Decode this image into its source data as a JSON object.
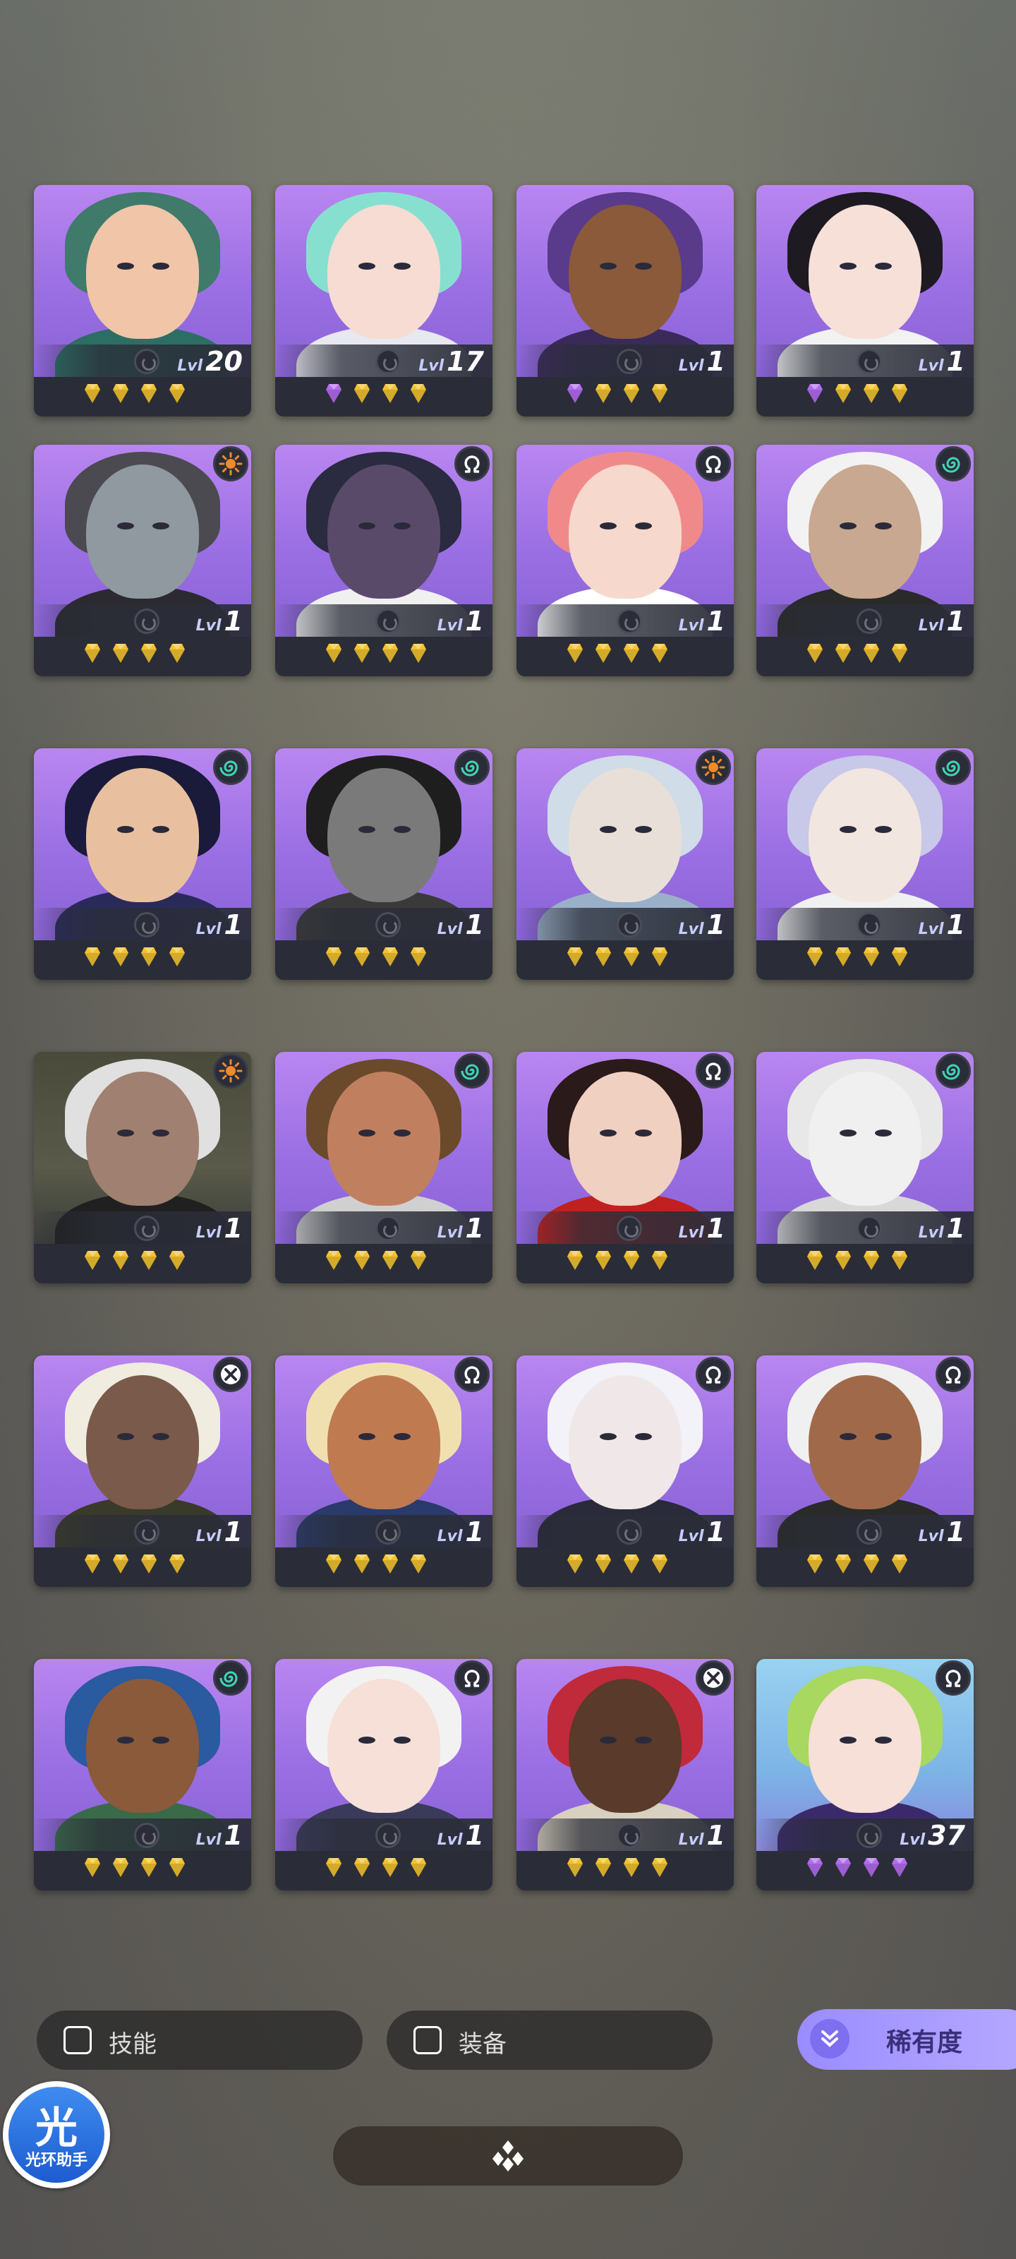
{
  "level_label": "Lvl",
  "heroes": [
    {
      "level": "20",
      "gems": [
        "gold",
        "gold",
        "gold",
        "gold"
      ],
      "badge": "",
      "palette": [
        "#3f7a6a",
        "#f1c5a8",
        "#2c6e63"
      ],
      "bg": "purple"
    },
    {
      "level": "17",
      "gems": [
        "purple",
        "gold",
        "gold",
        "gold"
      ],
      "badge": "",
      "palette": [
        "#87e0cf",
        "#f6dcd2",
        "#e8e8f0"
      ],
      "bg": "purple"
    },
    {
      "level": "1",
      "gems": [
        "purple",
        "gold",
        "gold",
        "gold"
      ],
      "badge": "",
      "palette": [
        "#5a3a8a",
        "#8a5a3a",
        "#3a2a5a"
      ],
      "bg": "purple"
    },
    {
      "level": "1",
      "gems": [
        "purple",
        "gold",
        "gold",
        "gold"
      ],
      "badge": "",
      "palette": [
        "#1e1a22",
        "#f6e0d8",
        "#f2f2f2"
      ],
      "bg": "purple"
    },
    {
      "level": "1",
      "gems": [
        "gold",
        "gold",
        "gold",
        "gold"
      ],
      "badge": "sun",
      "palette": [
        "#4a4a50",
        "#9098a0",
        "#2a2a30"
      ],
      "bg": "purple"
    },
    {
      "level": "1",
      "gems": [
        "gold",
        "gold",
        "gold",
        "gold"
      ],
      "badge": "omega",
      "palette": [
        "#2a2a40",
        "#5a4a6a",
        "#f0f0f0"
      ],
      "bg": "purple"
    },
    {
      "level": "1",
      "gems": [
        "gold",
        "gold",
        "gold",
        "gold"
      ],
      "badge": "omega",
      "palette": [
        "#f08a8a",
        "#f6d8cc",
        "#ffffff"
      ],
      "bg": "purple"
    },
    {
      "level": "1",
      "gems": [
        "gold",
        "gold",
        "gold",
        "gold"
      ],
      "badge": "spiral",
      "palette": [
        "#f2f2f2",
        "#c8a890",
        "#2a2a2a"
      ],
      "bg": "purple"
    },
    {
      "level": "1",
      "gems": [
        "gold",
        "gold",
        "gold",
        "gold"
      ],
      "badge": "spiral",
      "palette": [
        "#1a1a3a",
        "#e8c0a0",
        "#2a2a5a"
      ],
      "bg": "purple"
    },
    {
      "level": "1",
      "gems": [
        "gold",
        "gold",
        "gold",
        "gold"
      ],
      "badge": "spiral",
      "palette": [
        "#1e1e1e",
        "#7a7a7a",
        "#3a3a3a"
      ],
      "bg": "purple"
    },
    {
      "level": "1",
      "gems": [
        "gold",
        "gold",
        "gold",
        "gold"
      ],
      "badge": "sun",
      "palette": [
        "#d0dce8",
        "#e8e0d8",
        "#9ab0c8"
      ],
      "bg": "purple"
    },
    {
      "level": "1",
      "gems": [
        "gold",
        "gold",
        "gold",
        "gold"
      ],
      "badge": "spiral",
      "palette": [
        "#c8c8e8",
        "#f2e6e0",
        "#f0f0f0"
      ],
      "bg": "purple"
    },
    {
      "level": "1",
      "gems": [
        "gold",
        "gold",
        "gold",
        "gold"
      ],
      "badge": "sun",
      "palette": [
        "#e0e0e0",
        "#a08070",
        "#202020"
      ],
      "bg": "dark"
    },
    {
      "level": "1",
      "gems": [
        "gold",
        "gold",
        "gold",
        "gold"
      ],
      "badge": "spiral",
      "palette": [
        "#6a4a2a",
        "#c08060",
        "#d0d0d0"
      ],
      "bg": "purple"
    },
    {
      "level": "1",
      "gems": [
        "gold",
        "gold",
        "gold",
        "gold"
      ],
      "badge": "omega",
      "palette": [
        "#2a1a1a",
        "#f0d0c0",
        "#c02020"
      ],
      "bg": "purple"
    },
    {
      "level": "1",
      "gems": [
        "gold",
        "gold",
        "gold",
        "gold"
      ],
      "badge": "spiral",
      "palette": [
        "#e8e8e8",
        "#f0f0f0",
        "#d8d8d8"
      ],
      "bg": "purple"
    },
    {
      "level": "1",
      "gems": [
        "gold",
        "gold",
        "gold",
        "gold"
      ],
      "badge": "cross",
      "palette": [
        "#f0ece0",
        "#7a5a4a",
        "#3a3a2a"
      ],
      "bg": "purple"
    },
    {
      "level": "1",
      "gems": [
        "gold",
        "gold",
        "gold",
        "gold"
      ],
      "badge": "omega",
      "palette": [
        "#f0e0b0",
        "#c07a50",
        "#2a3a6a"
      ],
      "bg": "purple"
    },
    {
      "level": "1",
      "gems": [
        "gold",
        "gold",
        "gold",
        "gold"
      ],
      "badge": "omega",
      "palette": [
        "#f2f2f8",
        "#f0e8e8",
        "#2a2a3a"
      ],
      "bg": "purple"
    },
    {
      "level": "1",
      "gems": [
        "gold",
        "gold",
        "gold",
        "gold"
      ],
      "badge": "omega",
      "palette": [
        "#f0f0f0",
        "#a06a4a",
        "#2a2a2a"
      ],
      "bg": "purple"
    },
    {
      "level": "1",
      "gems": [
        "gold",
        "gold",
        "gold",
        "gold"
      ],
      "badge": "spiral",
      "palette": [
        "#2a5aa0",
        "#8a5a3a",
        "#3a6a4a"
      ],
      "bg": "purple"
    },
    {
      "level": "1",
      "gems": [
        "gold",
        "gold",
        "gold",
        "gold"
      ],
      "badge": "omega",
      "palette": [
        "#f2f2f2",
        "#f6e0d8",
        "#3a3a5a"
      ],
      "bg": "purple"
    },
    {
      "level": "1",
      "gems": [
        "gold",
        "gold",
        "gold",
        "gold"
      ],
      "badge": "cross",
      "palette": [
        "#c02a3a",
        "#5a3a2a",
        "#d8d0c0"
      ],
      "bg": "purple"
    },
    {
      "level": "37",
      "gems": [
        "purple",
        "purple",
        "purple",
        "purple"
      ],
      "badge": "omega",
      "palette": [
        "#a8d860",
        "#f6e0d8",
        "#3a2a6a"
      ],
      "bg": "sky"
    }
  ],
  "filters": {
    "skills_label": "技能",
    "equipment_label": "装备",
    "rarity_label": "稀有度"
  },
  "assistant": {
    "glyph": "光",
    "name": "光环助手"
  },
  "colors": {
    "gold_gem": "#f2c230",
    "purple_gem": "#b36cf0",
    "badge_sun": "#f08a2a",
    "badge_spiral": "#3fd6b6",
    "badge_omega": "#ffffff",
    "badge_cross": "#ffffff"
  }
}
